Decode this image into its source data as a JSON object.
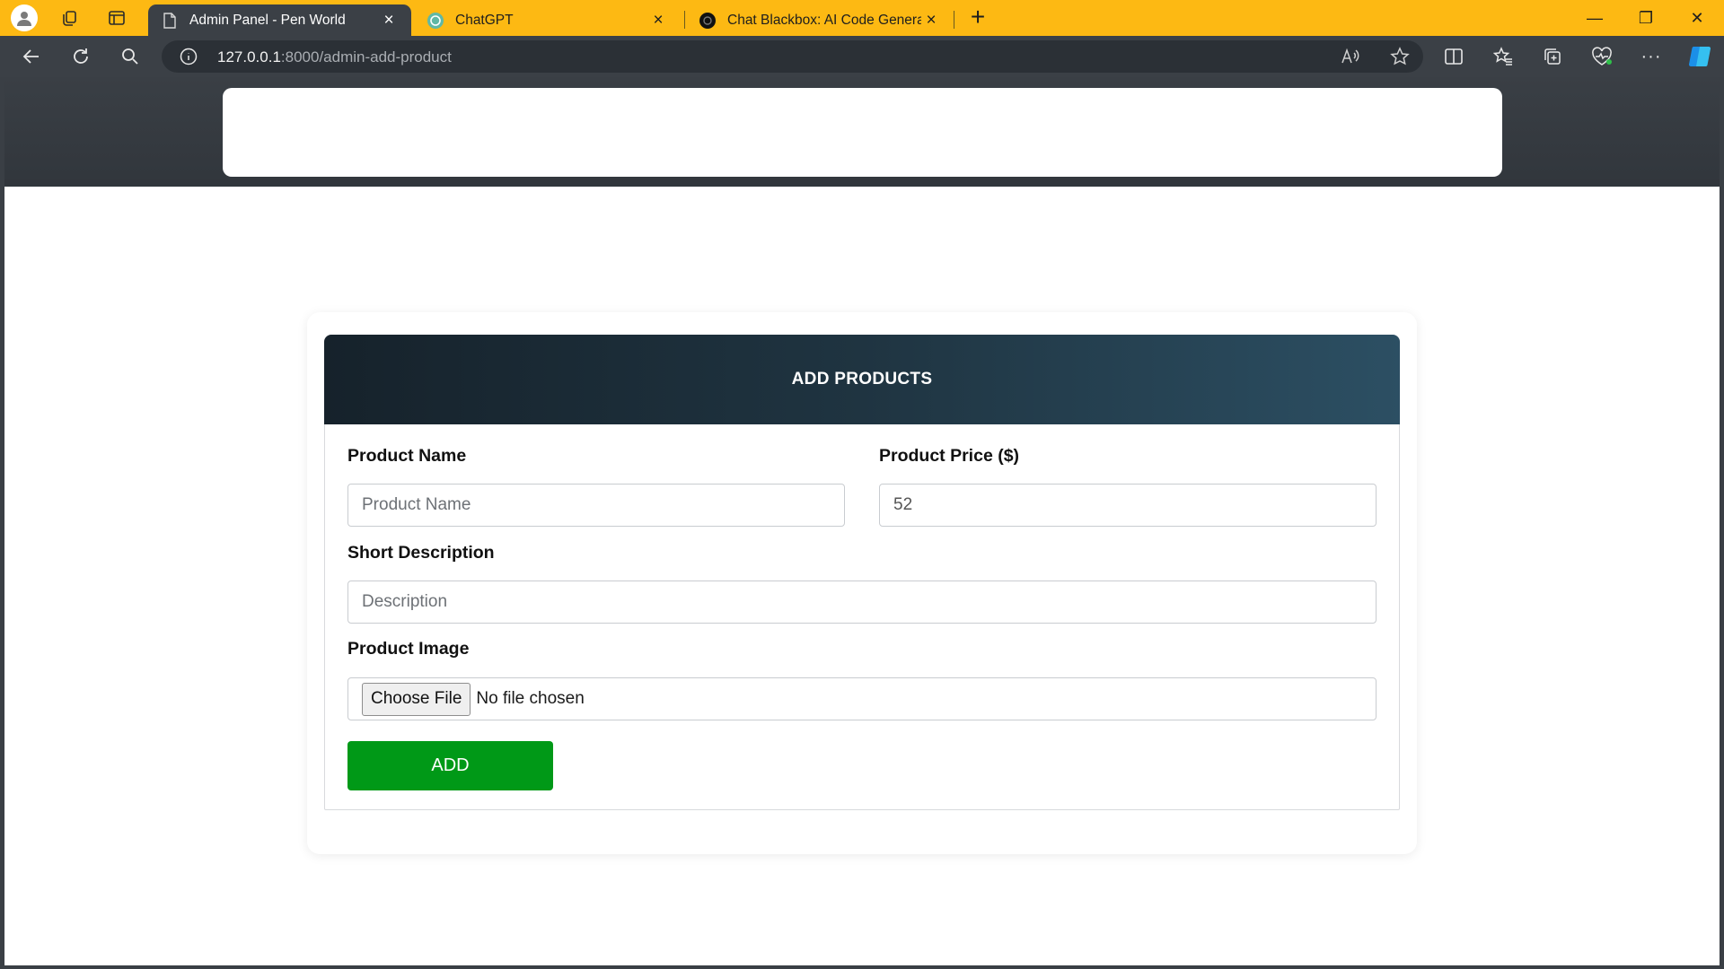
{
  "browser": {
    "tabs": [
      {
        "title": "Admin Panel - Pen World",
        "active": true,
        "close": "×"
      },
      {
        "title": "ChatGPT",
        "active": false,
        "close": "×"
      },
      {
        "title": "Chat Blackbox: AI Code Generatio",
        "active": false,
        "close": "×"
      }
    ],
    "new_tab": "+",
    "address": {
      "host": "127.0.0.1",
      "path": ":8000/admin-add-product"
    },
    "window_controls": {
      "minimize": "—",
      "restore": "❐",
      "close": "✕"
    },
    "colors": {
      "tab_strip": "#fdb913",
      "toolbar": "#3b4046"
    }
  },
  "form": {
    "title": "ADD PRODUCTS",
    "product_name": {
      "label": "Product Name",
      "placeholder": "Product Name",
      "value": ""
    },
    "product_price": {
      "label": "Product Price ($)",
      "placeholder": "",
      "value": "52"
    },
    "short_description": {
      "label": "Short Description",
      "placeholder": "Description",
      "value": ""
    },
    "product_image": {
      "label": "Product Image",
      "button": "Choose File",
      "status": "No file chosen"
    },
    "submit_label": "ADD",
    "colors": {
      "submit": "#009917",
      "header_start": "#16222b",
      "header_end": "#2c4f63"
    }
  }
}
